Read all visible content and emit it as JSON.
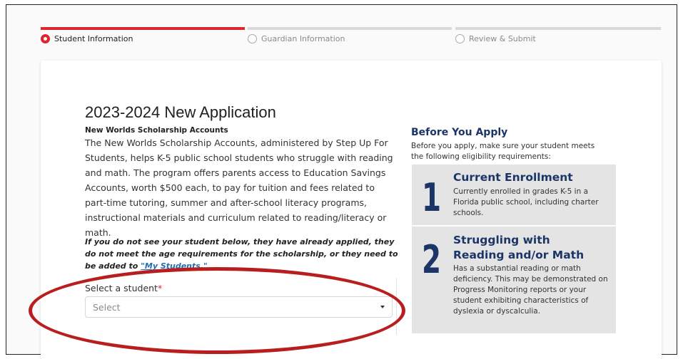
{
  "stepper": {
    "steps": [
      {
        "label": "Student Information",
        "active": true
      },
      {
        "label": "Guardian Information",
        "active": false
      },
      {
        "label": "Review & Submit",
        "active": false
      }
    ]
  },
  "main": {
    "title": "2023-2024 New Application",
    "subtitle": "New Worlds Scholarship Accounts",
    "description": "The New Worlds Scholarship Accounts, administered by Step Up For Students, helps K-5 public school students who struggle with reading and math. The program offers parents access to Education Savings Accounts, worth $500 each, to pay for tuition and fees related to part-time tutoring, summer and after-school literacy programs, instructional materials and curriculum related to reading/literacy or math.",
    "note_prefix": "If you do not see your student below, they have already applied, they do not meet the age requirements for the scholarship, or they need to be added to ",
    "note_link": "\"My Students.\"",
    "select_label": "Select a student",
    "select_required_mark": "*",
    "select_placeholder": "Select"
  },
  "sidebar": {
    "title": "Before You Apply",
    "text": "Before you apply, make sure your student meets the following eligibility requirements:",
    "requirements": [
      {
        "number": "1",
        "title": "Current Enrollment",
        "text": "Currently enrolled in grades K-5 in a Florida public school, including charter schools."
      },
      {
        "number": "2",
        "title": "Struggling with Reading and/or Math",
        "text": "Has a substantial reading or math deficiency. This may be demonstrated on Progress Monitoring reports or your student exhibiting characteristics of dyslexia or dyscalculia."
      }
    ]
  },
  "colors": {
    "accent": "#e0242f",
    "navy": "#1a3566",
    "annotation": "#b81e1e"
  }
}
